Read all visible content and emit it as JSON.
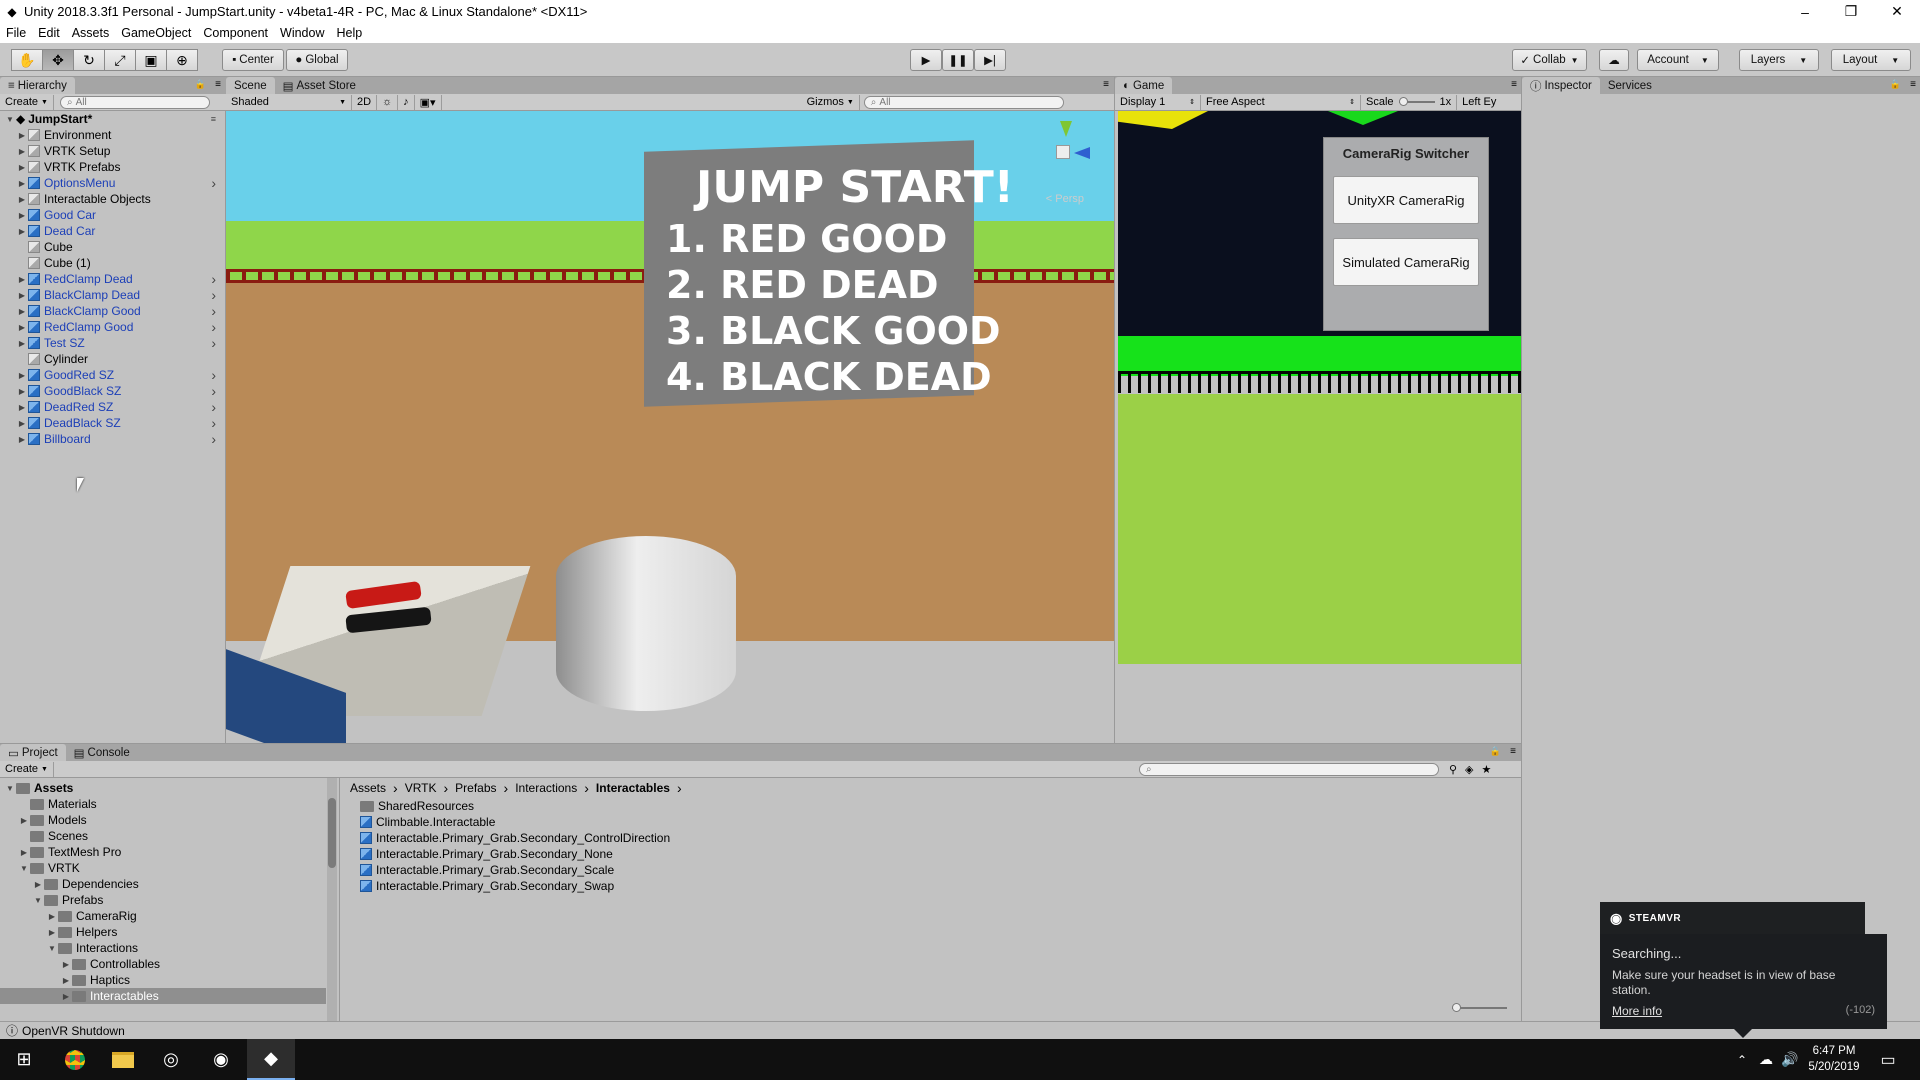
{
  "window": {
    "title": "Unity 2018.3.3f1 Personal - JumpStart.unity - v4beta1-4R - PC, Mac & Linux Standalone* <DX11>",
    "minimize_icon": "minimize-icon",
    "maximize_icon": "restore-icon",
    "close_icon": "close-icon"
  },
  "menu": [
    "File",
    "Edit",
    "Assets",
    "GameObject",
    "Component",
    "Window",
    "Help"
  ],
  "toolbar": {
    "pivot_label": "Center",
    "space_label": "Global",
    "collab_label": "Collab",
    "account_label": "Account",
    "layers_label": "Layers",
    "layout_label": "Layout"
  },
  "hierarchy": {
    "tab": "Hierarchy",
    "create_label": "Create",
    "search_placeholder": "All",
    "scene_name": "JumpStart*",
    "items": [
      {
        "label": "Environment",
        "prefab": false,
        "expandable": true,
        "more": false
      },
      {
        "label": "VRTK Setup",
        "prefab": false,
        "expandable": true,
        "more": false
      },
      {
        "label": "VRTK Prefabs",
        "prefab": false,
        "expandable": true,
        "more": false
      },
      {
        "label": "OptionsMenu",
        "prefab": true,
        "expandable": true,
        "more": true
      },
      {
        "label": "Interactable Objects",
        "prefab": false,
        "expandable": true,
        "more": false
      },
      {
        "label": "Good Car",
        "prefab": true,
        "expandable": true,
        "more": false
      },
      {
        "label": "Dead Car",
        "prefab": true,
        "expandable": true,
        "more": false
      },
      {
        "label": "Cube",
        "prefab": false,
        "expandable": false,
        "more": false
      },
      {
        "label": "Cube (1)",
        "prefab": false,
        "expandable": false,
        "more": false
      },
      {
        "label": "RedClamp Dead",
        "prefab": true,
        "expandable": true,
        "more": true
      },
      {
        "label": "BlackClamp Dead",
        "prefab": true,
        "expandable": true,
        "more": true
      },
      {
        "label": "BlackClamp Good",
        "prefab": true,
        "expandable": true,
        "more": true
      },
      {
        "label": "RedClamp Good",
        "prefab": true,
        "expandable": true,
        "more": true
      },
      {
        "label": "Test SZ",
        "prefab": true,
        "expandable": true,
        "more": true
      },
      {
        "label": "Cylinder",
        "prefab": false,
        "expandable": false,
        "more": false
      },
      {
        "label": "GoodRed SZ",
        "prefab": true,
        "expandable": true,
        "more": true
      },
      {
        "label": "GoodBlack SZ",
        "prefab": true,
        "expandable": true,
        "more": true
      },
      {
        "label": "DeadRed SZ",
        "prefab": true,
        "expandable": true,
        "more": true
      },
      {
        "label": "DeadBlack SZ",
        "prefab": true,
        "expandable": true,
        "more": true
      },
      {
        "label": "Billboard",
        "prefab": true,
        "expandable": true,
        "more": true
      }
    ]
  },
  "scene": {
    "tabs": [
      "Scene",
      "Asset Store"
    ],
    "shading_label": "Shaded",
    "mode_2d": "2D",
    "gizmos_label": "Gizmos",
    "search_placeholder": "All",
    "persp_label": "< Persp",
    "billboard_lines": [
      "JUMP START!",
      "1. RED GOOD",
      "2. RED DEAD",
      "3. BLACK GOOD",
      "4. BLACK DEAD"
    ]
  },
  "game": {
    "tab": "Game",
    "display_label": "Display 1",
    "aspect_label": "Free Aspect",
    "scale_label": "Scale",
    "scale_value": "1x",
    "eye_label": "Left Ey",
    "switcher_title": "CameraRig Switcher",
    "btn_unityxr": "UnityXR CameraRig",
    "btn_simulated": "Simulated CameraRig"
  },
  "inspector": {
    "tabs": [
      "Inspector",
      "Services"
    ]
  },
  "project": {
    "tabs": [
      "Project",
      "Console"
    ],
    "create_label": "Create",
    "tree": [
      {
        "label": "Assets",
        "depth": 0,
        "open": true,
        "bold": true
      },
      {
        "label": "Materials",
        "depth": 1,
        "open": false,
        "leaf": true
      },
      {
        "label": "Models",
        "depth": 1,
        "open": false
      },
      {
        "label": "Scenes",
        "depth": 1,
        "open": false,
        "leaf": true
      },
      {
        "label": "TextMesh Pro",
        "depth": 1,
        "open": false
      },
      {
        "label": "VRTK",
        "depth": 1,
        "open": true
      },
      {
        "label": "Dependencies",
        "depth": 2,
        "open": false
      },
      {
        "label": "Prefabs",
        "depth": 2,
        "open": true
      },
      {
        "label": "CameraRig",
        "depth": 3,
        "open": false
      },
      {
        "label": "Helpers",
        "depth": 3,
        "open": false
      },
      {
        "label": "Interactions",
        "depth": 3,
        "open": true
      },
      {
        "label": "Controllables",
        "depth": 4,
        "open": false
      },
      {
        "label": "Haptics",
        "depth": 4,
        "open": false
      },
      {
        "label": "Interactables",
        "depth": 4,
        "open": false,
        "selected": true
      }
    ],
    "breadcrumb": [
      "Assets",
      "VRTK",
      "Prefabs",
      "Interactions",
      "Interactables"
    ],
    "files": [
      {
        "label": "SharedResources",
        "type": "folder"
      },
      {
        "label": "Climbable.Interactable",
        "type": "prefab"
      },
      {
        "label": "Interactable.Primary_Grab.Secondary_ControlDirection",
        "type": "prefab"
      },
      {
        "label": "Interactable.Primary_Grab.Secondary_None",
        "type": "prefab"
      },
      {
        "label": "Interactable.Primary_Grab.Secondary_Scale",
        "type": "prefab"
      },
      {
        "label": "Interactable.Primary_Grab.Secondary_Swap",
        "type": "prefab"
      }
    ]
  },
  "status": {
    "message": "OpenVR Shutdown"
  },
  "steamvr": {
    "brand": "STEAMVR",
    "heading": "Searching...",
    "message": "Make sure your headset is in view of base station.",
    "link": "More info",
    "code": "(-102)"
  },
  "taskbar": {
    "time": "6:47 PM",
    "date": "5/20/2019"
  },
  "colors": {
    "prefab_text": "#1c3fb7",
    "panel_bg": "#c2c2c2",
    "sky": "#69d0ea",
    "grass": "#8fd64a",
    "ground": "#b98a57"
  }
}
